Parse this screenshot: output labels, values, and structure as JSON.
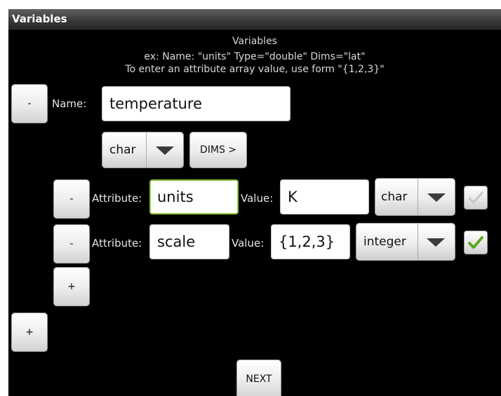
{
  "window": {
    "title": "Variables"
  },
  "header": {
    "heading": "Variables",
    "example": "ex: Name: \"units\" Type=\"double\" Dims=\"lat\"",
    "instruction": "To enter an attribute array value, use form \"{1,2,3}\""
  },
  "variable": {
    "remove_label": "-",
    "name_label": "Name:",
    "name_value": "temperature",
    "type_value": "char",
    "dims_label": "DIMS >"
  },
  "attributes": [
    {
      "remove_label": "-",
      "attribute_label": "Attribute:",
      "name": "units",
      "value_label": "Value:",
      "value": "K",
      "type": "char",
      "checked": false
    },
    {
      "remove_label": "-",
      "attribute_label": "Attribute:",
      "name": "scale",
      "value_label": "Value:",
      "value": "{1,2,3}",
      "type": "integer",
      "checked": true
    }
  ],
  "add_attribute_label": "+",
  "add_variable_label": "+",
  "next_label": "NEXT",
  "colors": {
    "background": "#000000",
    "focus_border": "#8cc63f",
    "check_green": "#5aa81e",
    "check_gray": "#c8c8c8"
  }
}
